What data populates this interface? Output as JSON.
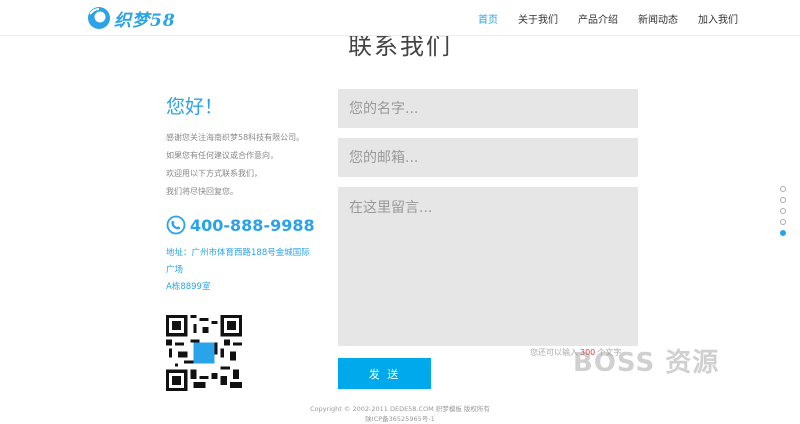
{
  "header": {
    "logo_text": "织梦58",
    "nav": [
      {
        "label": "首页",
        "active": true
      },
      {
        "label": "关于我们",
        "active": false
      },
      {
        "label": "产品介绍",
        "active": false
      },
      {
        "label": "新闻动态",
        "active": false
      },
      {
        "label": "加入我们",
        "active": false
      }
    ]
  },
  "page_title": "联系我们",
  "contact": {
    "greeting": "您好！",
    "intro_lines": [
      "感谢您关注海南织梦58科技有限公司。",
      "如果您有任何建议或合作意向，",
      "欢迎用以下方式联系我们，",
      "我们将尽快回复您。"
    ],
    "phone": "400-888-9988",
    "address_lines": [
      "地址：广州市体育西路188号金城国际",
      "广场",
      "A栋8899室"
    ]
  },
  "form": {
    "name_placeholder": "您的名字...",
    "email_placeholder": "您的邮箱...",
    "message_placeholder": "在这里留言...",
    "counter_prefix": "您还可以输入",
    "counter_value": "300",
    "counter_suffix": "个文字",
    "send_label": "发 送"
  },
  "watermark": "BOSS 资源",
  "footer": {
    "copyright": "Copyright © 2002-2011 DEDE58.COM 织梦模板 版权所有",
    "icp": "陕ICP备36525965号-1"
  },
  "pager": {
    "count": 5,
    "active_index": 4
  },
  "colors": {
    "accent": "#29a3ea",
    "button": "#00a8ec",
    "field_bg": "#e6e6e6",
    "counter_number": "#e4393c"
  }
}
